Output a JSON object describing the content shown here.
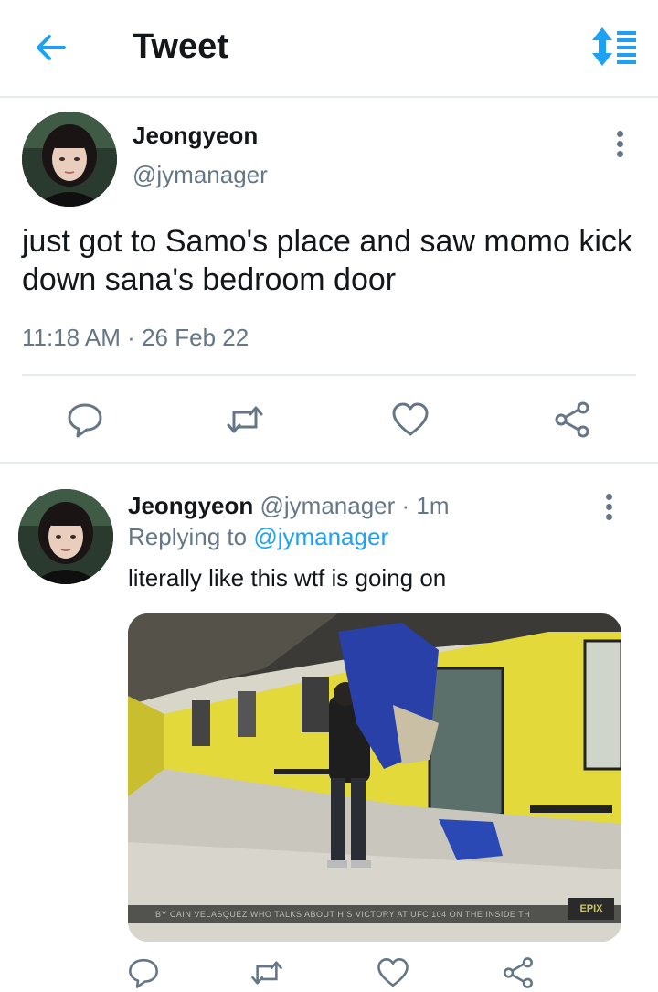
{
  "topbar": {
    "title": "Tweet",
    "back_icon": "arrow-left-icon",
    "sort_icon": "sort-icon",
    "accent": "#1da1f2"
  },
  "main_tweet": {
    "author_name": "Jeongyeon",
    "author_handle": "@jymanager",
    "text": "just got to Samo's place and saw momo kick down sana's bedroom door",
    "time": "11:18 AM",
    "separator": "·",
    "date": "26 Feb 22",
    "actions": [
      "reply-icon",
      "retweet-icon",
      "like-icon",
      "share-icon"
    ]
  },
  "reply_tweet": {
    "author_name": "Jeongyeon",
    "author_handle": "@jymanager",
    "separator": "·",
    "age": "1m",
    "replying_prefix": "Replying to",
    "replying_to": "@jymanager",
    "text": "literally like this wtf is going on",
    "media_caption": "BY CAIN VELASQUEZ WHO TALKS ABOUT HIS VICTORY AT UFC 104 ON THE INSIDE TH",
    "media_logo": "EPIX",
    "actions": [
      "reply-icon",
      "retweet-icon",
      "like-icon",
      "share-icon"
    ]
  },
  "colors": {
    "text_primary": "#14171a",
    "text_secondary": "#657786",
    "link": "#1da1f2",
    "divider": "#e6ecf0"
  }
}
